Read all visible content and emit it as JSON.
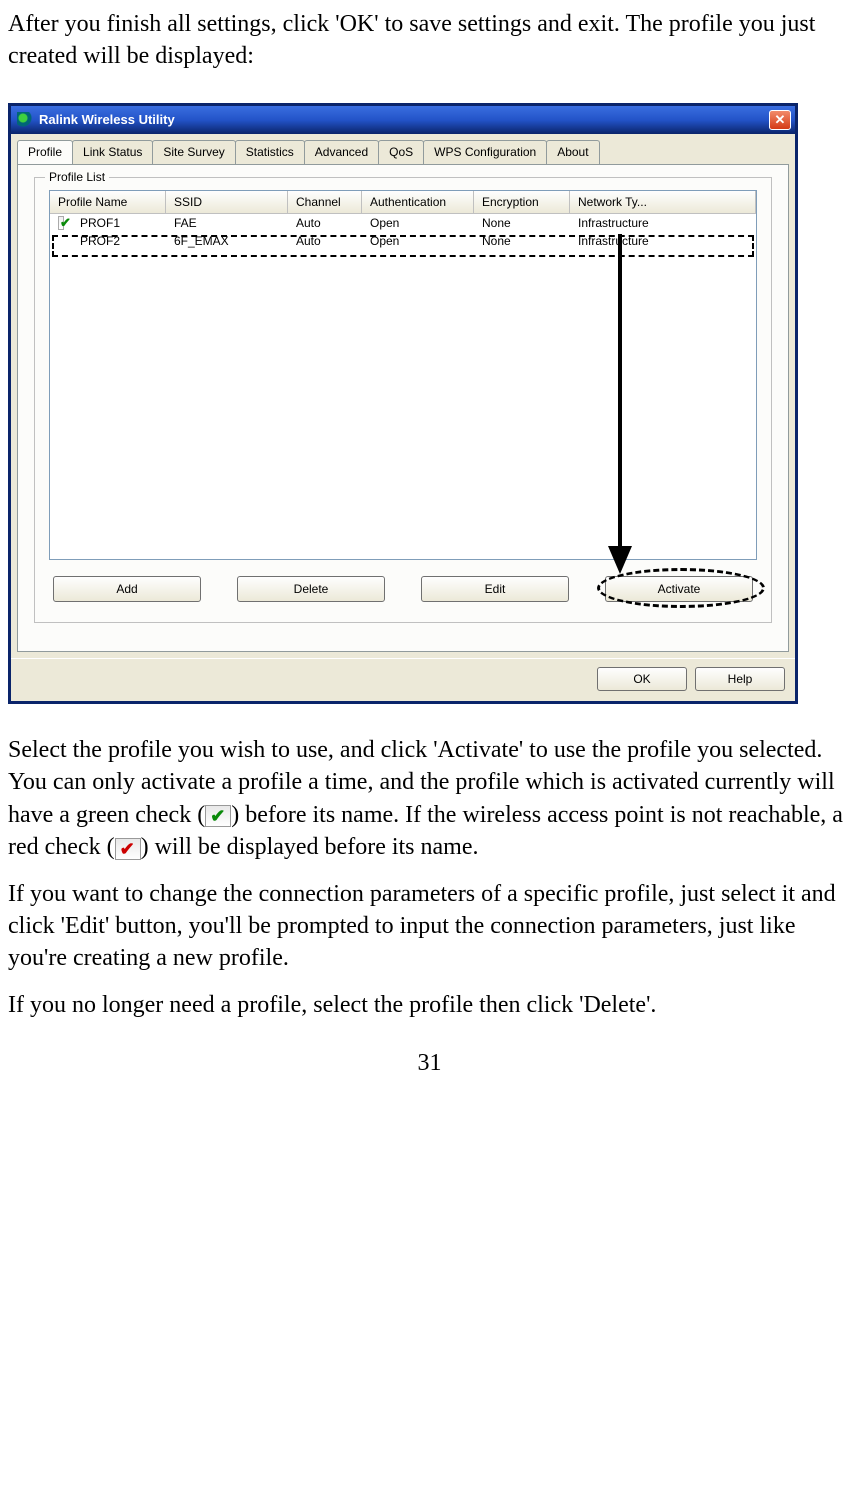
{
  "intro_text": "After you finish all settings, click 'OK' to save settings and exit. The profile you just created will be displayed:",
  "window": {
    "title": "Ralink Wireless Utility",
    "tabs": [
      "Profile",
      "Link Status",
      "Site Survey",
      "Statistics",
      "Advanced",
      "QoS",
      "WPS Configuration",
      "About"
    ],
    "active_tab": "Profile",
    "groupbox_label": "Profile List",
    "columns": [
      "Profile Name",
      "SSID",
      "Channel",
      "Authentication",
      "Encryption",
      "Network Ty..."
    ],
    "rows": [
      {
        "active": true,
        "profile_name": "PROF1",
        "ssid": "FAE",
        "channel": "Auto",
        "auth": "Open",
        "enc": "None",
        "net": "Infrastructure"
      },
      {
        "active": false,
        "profile_name": "PROF2",
        "ssid": "6F_EMAX",
        "channel": "Auto",
        "auth": "Open",
        "enc": "None",
        "net": "Infrastructure"
      }
    ],
    "buttons": {
      "add": "Add",
      "delete": "Delete",
      "edit": "Edit",
      "activate": "Activate"
    },
    "dialog_buttons": {
      "ok": "OK",
      "help": "Help"
    }
  },
  "para2_a": "Select the profile you wish to use, and click 'Activate' to use the profile you selected. You can only activate a profile a time, and the profile which is activated currently will have a green check (",
  "para2_b": ") before its name. If the wireless access point is not reachable, a red check (",
  "para2_c": ") will be displayed before its name.",
  "para3": "If you want to change the connection parameters of a specific profile, just select it and click 'Edit' button, you'll be prompted to input the connection parameters, just like you're creating a new profile.",
  "para4": "If you no longer need a profile, select the profile then click 'Delete'.",
  "page_number": "31"
}
